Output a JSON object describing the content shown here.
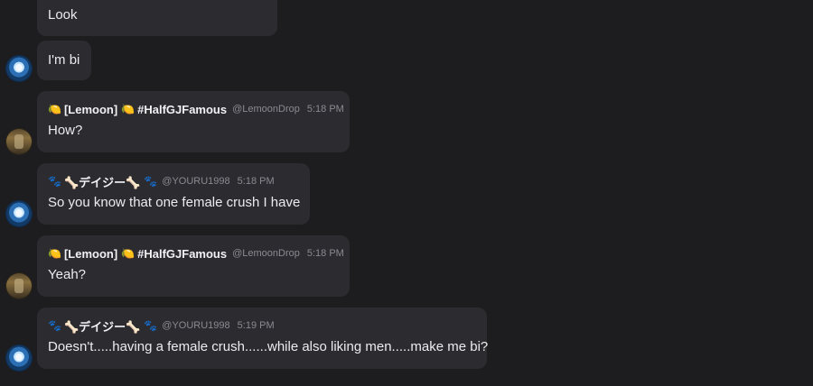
{
  "messages": [
    {
      "id": "m0",
      "author_type": "daisy",
      "show_header": false,
      "show_avatar": false,
      "text": "Look"
    },
    {
      "id": "m1",
      "author_type": "daisy",
      "show_header": false,
      "show_avatar": true,
      "text": "I'm bi"
    },
    {
      "id": "m2",
      "author_type": "lemoon",
      "show_header": true,
      "show_avatar": true,
      "emoji1": "🍋",
      "name1": "[Lemoon]",
      "emoji2": "🍋",
      "name2": "#HalfGJFamous",
      "handle": "@LemoonDrop",
      "time": "5:18 PM",
      "text": "How?"
    },
    {
      "id": "m3",
      "author_type": "daisy",
      "show_header": true,
      "show_avatar": true,
      "emoji1": "🐾",
      "name1": "🦴デイジー🦴",
      "emoji2": "🐾",
      "handle": "@YOURU1998",
      "time": "5:18 PM",
      "text": "So you know that one female crush I have"
    },
    {
      "id": "m4",
      "author_type": "lemoon",
      "show_header": true,
      "show_avatar": true,
      "emoji1": "🍋",
      "name1": "[Lemoon]",
      "emoji2": "🍋",
      "name2": "#HalfGJFamous",
      "handle": "@LemoonDrop",
      "time": "5:18 PM",
      "text": "Yeah?"
    },
    {
      "id": "m5",
      "author_type": "daisy",
      "show_header": true,
      "show_avatar": true,
      "emoji1": "🐾",
      "name1": "🦴デイジー🦴",
      "emoji2": "🐾",
      "handle": "@YOURU1998",
      "time": "5:19 PM",
      "text": "Doesn't.....having a female crush......while also liking men.....make me bi?"
    }
  ],
  "colors": {
    "background": "#1d1d20",
    "bubble": "#2b2b30",
    "meta_text": "#8a8a90"
  },
  "avatars": {
    "daisy": "blue-round-avatar-icon",
    "lemoon": "brown-figure-avatar-icon"
  }
}
